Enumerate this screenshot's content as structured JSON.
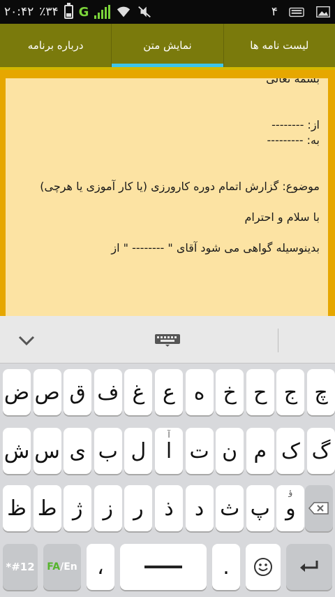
{
  "status_bar": {
    "time": "۲۰:۴۲",
    "battery_percent": "٪۳۴",
    "battery_level": 0.34,
    "network_type": "G",
    "notification_count": "۴",
    "icons": [
      "battery-icon",
      "signal-icon",
      "wifi-icon",
      "mute-icon",
      "keyboard-icon",
      "image-icon"
    ]
  },
  "tabs": [
    {
      "label": "درباره برنامه",
      "active": false
    },
    {
      "label": "نمایش متن",
      "active": true
    },
    {
      "label": "لیست نامه ها",
      "active": false
    }
  ],
  "letter": {
    "text": "بسمه تعالی\n\n\nاز: --------\nبه: ---------\n\n\nموضوع: گزارش اتمام دوره کارورزی (یا کار آموزی یا هرچی)\n\nبا سلام و احترام\n\nبدینوسیله گواهی می شود آقای \" -------- \" از"
  },
  "keyboard": {
    "toolbar_icons": [
      "chevron-down-icon",
      "keyboard-icon"
    ],
    "row1": [
      "چ",
      "ج",
      "ح",
      "خ",
      "ه",
      "ع",
      "غ",
      "ف",
      "ق",
      "ص",
      "ض"
    ],
    "row2": [
      "گ",
      "ک",
      "م",
      "ن",
      "ت",
      "ا",
      "ل",
      "ب",
      "ی",
      "س",
      "ش"
    ],
    "row3_keys": [
      "و",
      "پ",
      "ث",
      "د",
      "ذ",
      "ر",
      "ز",
      "ژ",
      "ط",
      "ظ"
    ],
    "row3_vav_sup": "ؤ",
    "row2_alef_sup": "آ",
    "symbols_label": "*#12",
    "lang_fa": "FA",
    "lang_sep": "/",
    "lang_en": "En",
    "comma": "،",
    "period": "."
  }
}
